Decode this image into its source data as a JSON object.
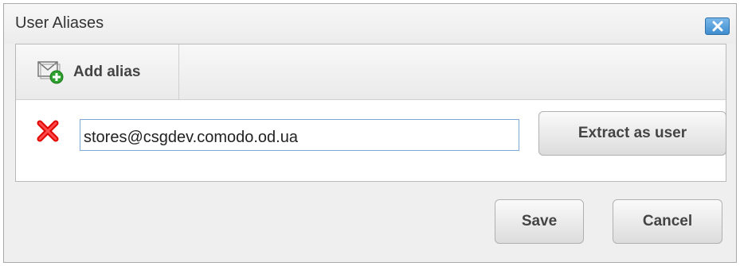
{
  "dialog": {
    "title": "User Aliases",
    "close_icon": "close-icon"
  },
  "toolbar": {
    "add_alias_label": "Add alias",
    "add_alias_icon": "add-alias-icon"
  },
  "aliases": [
    {
      "value": "stores@csgdev.comodo.od.ua",
      "delete_icon": "delete-icon",
      "extract_label": "Extract as user"
    }
  ],
  "footer": {
    "save_label": "Save",
    "cancel_label": "Cancel"
  },
  "colors": {
    "close_button": "#4a95d6",
    "delete_icon": "#e00000",
    "add_icon_plus": "#2ea02e",
    "input_border": "#7aa7d6"
  }
}
